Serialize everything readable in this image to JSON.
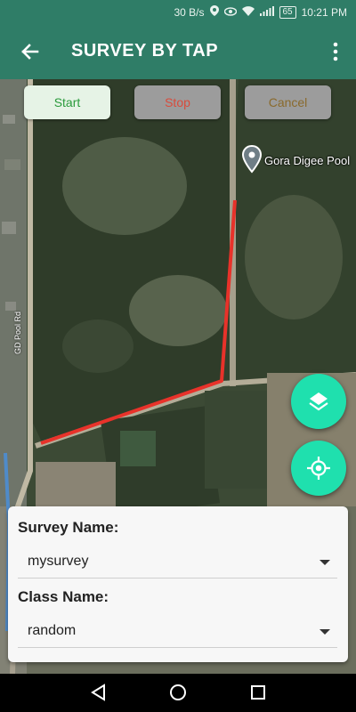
{
  "status_bar": {
    "speed": "30 B/s",
    "battery": "65",
    "time": "10:21 PM"
  },
  "app_bar": {
    "title": "SURVEY BY TAP",
    "back_icon": "arrow-back-icon",
    "menu_icon": "more-vert-icon"
  },
  "toolbar": {
    "start_label": "Start",
    "stop_label": "Stop",
    "cancel_label": "Cancel"
  },
  "map": {
    "place_label": "Gora Digee Pool",
    "road_label": "GD Pool Rd",
    "track_color": "#e8322a"
  },
  "fabs": {
    "layers_icon": "layers-icon",
    "locate_icon": "my-location-icon",
    "color": "#1fe0ae"
  },
  "form": {
    "survey_label": "Survey Name:",
    "survey_value": "mysurvey",
    "class_label": "Class Name:",
    "class_value": "random"
  },
  "colors": {
    "primary": "#2f7d67"
  }
}
